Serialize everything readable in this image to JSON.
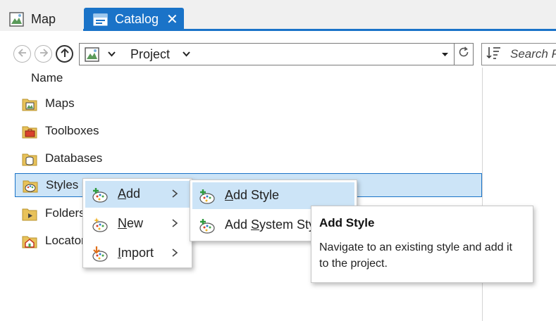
{
  "tabs": [
    {
      "label": "Map",
      "icon": "map-icon",
      "active": false
    },
    {
      "label": "Catalog",
      "icon": "catalog-icon",
      "active": true,
      "close": "✕"
    }
  ],
  "toolbar": {
    "path_label": "Project",
    "search_placeholder": "Search P"
  },
  "tree": {
    "column_header": "Name",
    "items": [
      {
        "label": "Maps",
        "icon": "maps-folder-icon"
      },
      {
        "label": "Toolboxes",
        "icon": "toolboxes-folder-icon"
      },
      {
        "label": "Databases",
        "icon": "databases-folder-icon"
      },
      {
        "label": "Styles",
        "icon": "styles-folder-icon",
        "selected": true
      },
      {
        "label": "Folders",
        "icon": "folders-folder-icon"
      },
      {
        "label": "Locators",
        "icon": "locators-folder-icon"
      }
    ]
  },
  "context_menu": {
    "items": [
      {
        "pre": "",
        "u": "A",
        "post": "dd",
        "icon": "add-style-icon",
        "hover": true
      },
      {
        "pre": "",
        "u": "N",
        "post": "ew",
        "icon": "new-style-icon"
      },
      {
        "pre": "",
        "u": "I",
        "post": "mport",
        "icon": "import-style-icon"
      }
    ]
  },
  "submenu": {
    "items": [
      {
        "pre": "",
        "u": "A",
        "post": "dd Style",
        "icon": "add-style-icon",
        "hover": true
      },
      {
        "pre": "Add ",
        "u": "S",
        "post": "ystem Style",
        "icon": "add-system-style-icon"
      }
    ]
  },
  "tooltip": {
    "title": "Add Style",
    "body": "Navigate to an existing style and add it to the project."
  },
  "colors": {
    "accent": "#1a73c8",
    "selection": "#cce4f7",
    "folder": "#e8c25a"
  }
}
